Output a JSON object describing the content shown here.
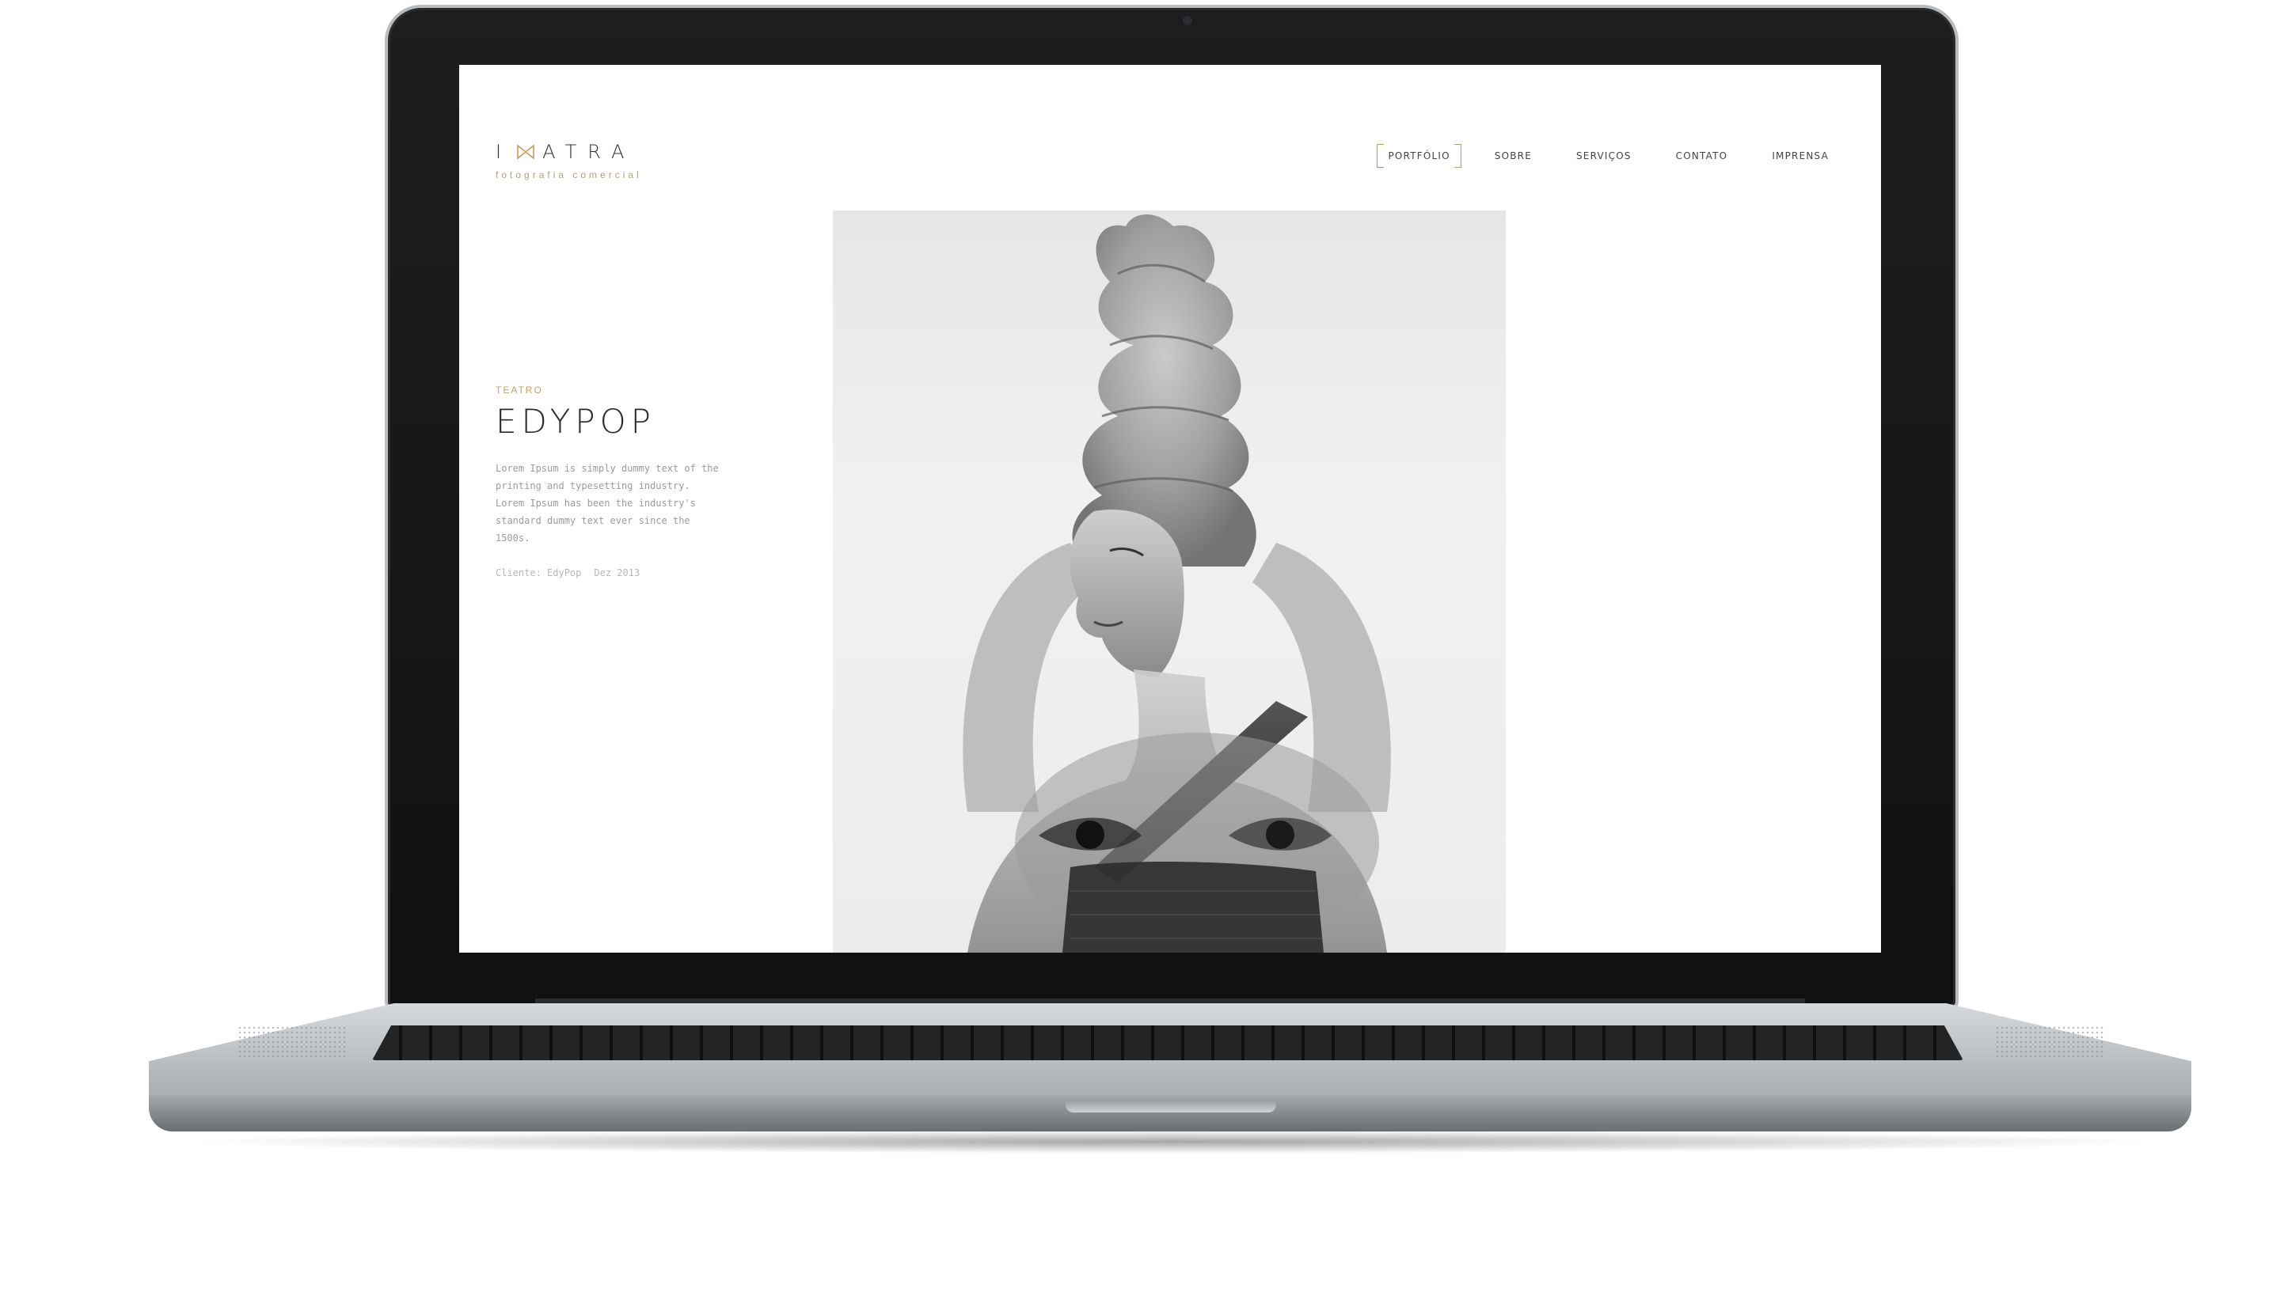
{
  "site": {
    "logo": "IMATRA",
    "tagline": "fotografia comercial"
  },
  "nav": {
    "items": [
      {
        "label": "PORTFÓLIO",
        "active": true
      },
      {
        "label": "SOBRE",
        "active": false
      },
      {
        "label": "SERVIÇOS",
        "active": false
      },
      {
        "label": "CONTATO",
        "active": false
      },
      {
        "label": "IMPRENSA",
        "active": false
      }
    ]
  },
  "project": {
    "category": "TEATRO",
    "title": "EDYPOP",
    "description": "Lorem Ipsum is simply dummy text of the printing and typesetting industry. Lorem Ipsum has been the industry's standard dummy text ever since the 1500s.",
    "client": "Cliente: EdyPop",
    "date": "Dez 2013"
  },
  "colors": {
    "accent": "#c29b62",
    "text": "#333333"
  }
}
